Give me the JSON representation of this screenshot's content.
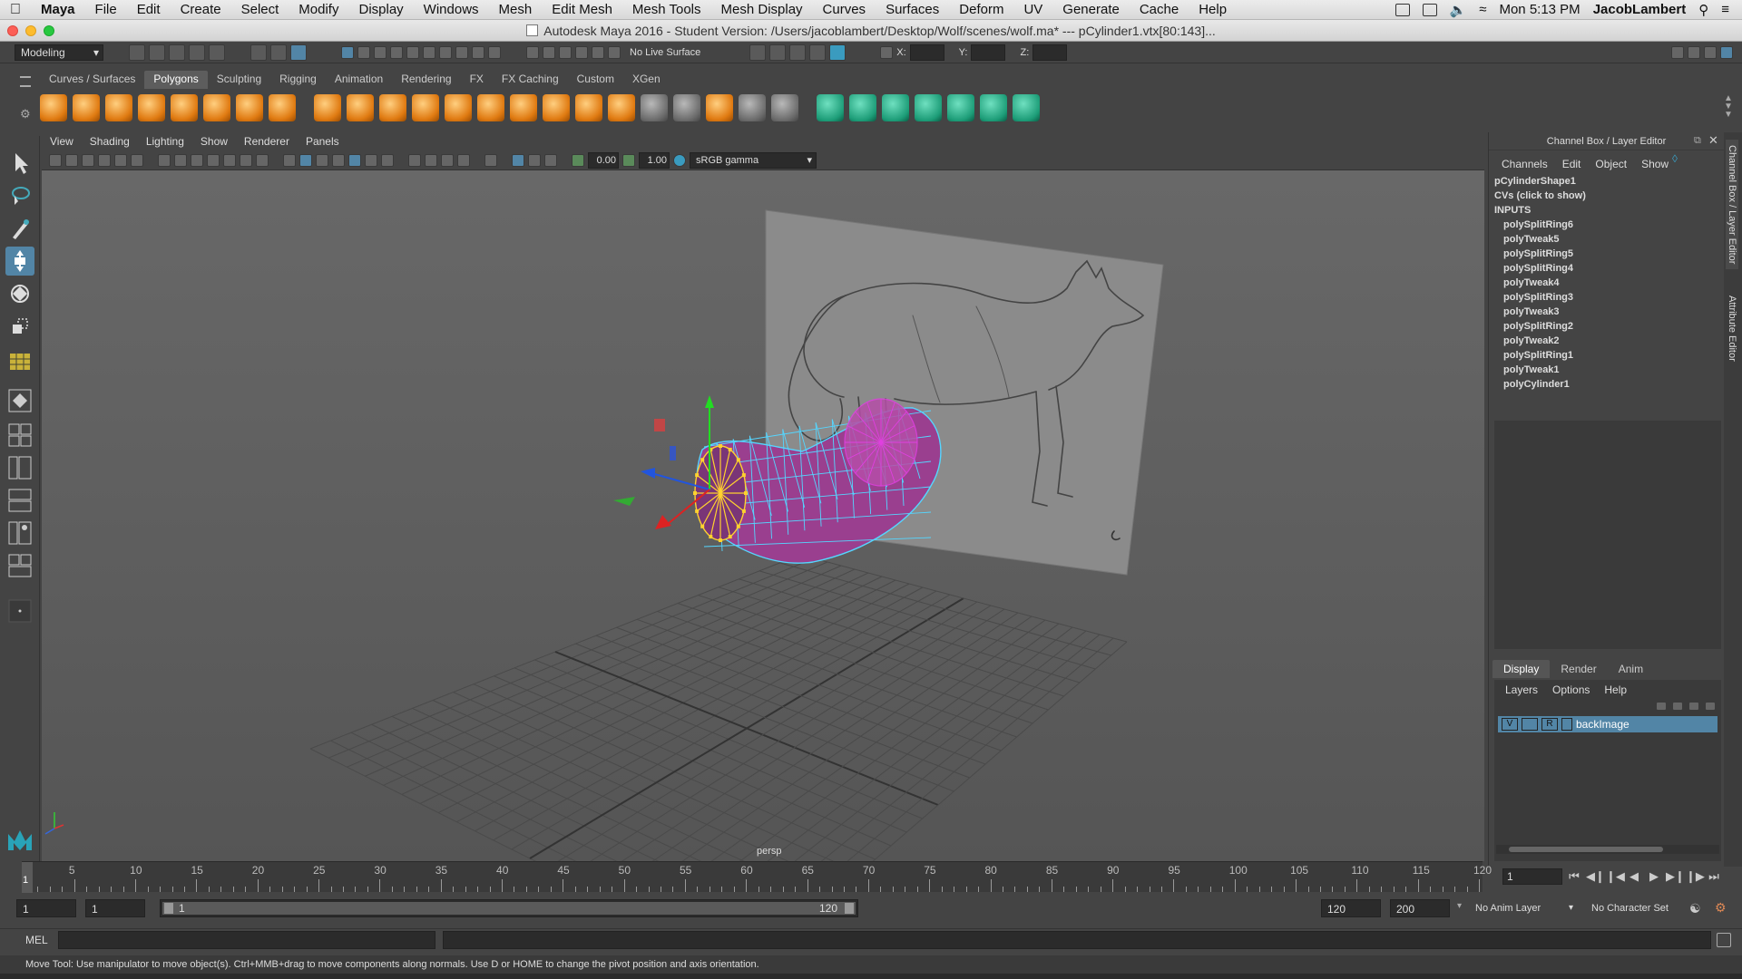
{
  "menubar": {
    "app_name": "Maya",
    "items": [
      "File",
      "Edit",
      "Create",
      "Select",
      "Modify",
      "Display",
      "Windows",
      "Mesh",
      "Edit Mesh",
      "Mesh Tools",
      "Mesh Display",
      "Curves",
      "Surfaces",
      "Deform",
      "UV",
      "Generate",
      "Cache",
      "Help"
    ],
    "clock": "Mon 5:13 PM",
    "user": "JacobLambert"
  },
  "window": {
    "title": "Autodesk Maya 2016 - Student Version: /Users/jacoblambert/Desktop/Wolf/scenes/wolf.ma*  ---  pCylinder1.vtx[80:143]..."
  },
  "statusline": {
    "menuset": "Modeling",
    "live_surface": "No Live Surface",
    "x_label": "X:",
    "y_label": "Y:",
    "z_label": "Z:"
  },
  "shelf": {
    "tabs": [
      "Curves / Surfaces",
      "Polygons",
      "Sculpting",
      "Rigging",
      "Animation",
      "Rendering",
      "FX",
      "FX Caching",
      "Custom",
      "XGen"
    ],
    "active_tab": "Polygons"
  },
  "viewport": {
    "menu": [
      "View",
      "Shading",
      "Lighting",
      "Show",
      "Renderer",
      "Panels"
    ],
    "near_value": "0.00",
    "gamma_value": "1.00",
    "color_space": "sRGB gamma",
    "camera_label": "persp",
    "colors": {
      "mesh_wire": "#55d6ff",
      "mesh_fill": "#9a3f8f",
      "selected_verts": "#ffd22e",
      "highlight": "#e040e0"
    }
  },
  "channel_box": {
    "title": "Channel Box / Layer Editor",
    "menu": [
      "Channels",
      "Edit",
      "Object",
      "Show"
    ],
    "shape": "pCylinderShape1",
    "cvs": "CVs (click to show)",
    "inputs_label": "INPUTS",
    "inputs": [
      "polySplitRing6",
      "polyTweak5",
      "polySplitRing5",
      "polySplitRing4",
      "polyTweak4",
      "polySplitRing3",
      "polyTweak3",
      "polySplitRing2",
      "polyTweak2",
      "polySplitRing1",
      "polyTweak1",
      "polyCylinder1"
    ],
    "layer_tabs": [
      "Display",
      "Render",
      "Anim"
    ],
    "active_layer_tab": "Display",
    "layer_menu": [
      "Layers",
      "Options",
      "Help"
    ],
    "layer": {
      "v": "V",
      "r": "R",
      "name": "backImage"
    },
    "side_tabs": [
      "Channel Box / Layer Editor",
      "Attribute Editor"
    ]
  },
  "timeslider": {
    "ticks": [
      "5",
      "10",
      "15",
      "20",
      "25",
      "30",
      "35",
      "40",
      "45",
      "50",
      "55",
      "60",
      "65",
      "70",
      "75",
      "80",
      "85",
      "90",
      "95",
      "100",
      "105",
      "110",
      "115",
      "120"
    ],
    "current_frame": "1",
    "current_frame_field": "1"
  },
  "range": {
    "start": "1",
    "playback_start": "1",
    "slider_start": "1",
    "slider_end": "120",
    "playback_end": "120",
    "end": "200",
    "anim_layer": "No Anim Layer",
    "character_set": "No Character Set"
  },
  "cmdline": {
    "lang": "MEL"
  },
  "helpline": {
    "text": "Move Tool: Use manipulator to move object(s). Ctrl+MMB+drag to move components along normals. Use D or HOME to change the pivot position and axis orientation."
  }
}
